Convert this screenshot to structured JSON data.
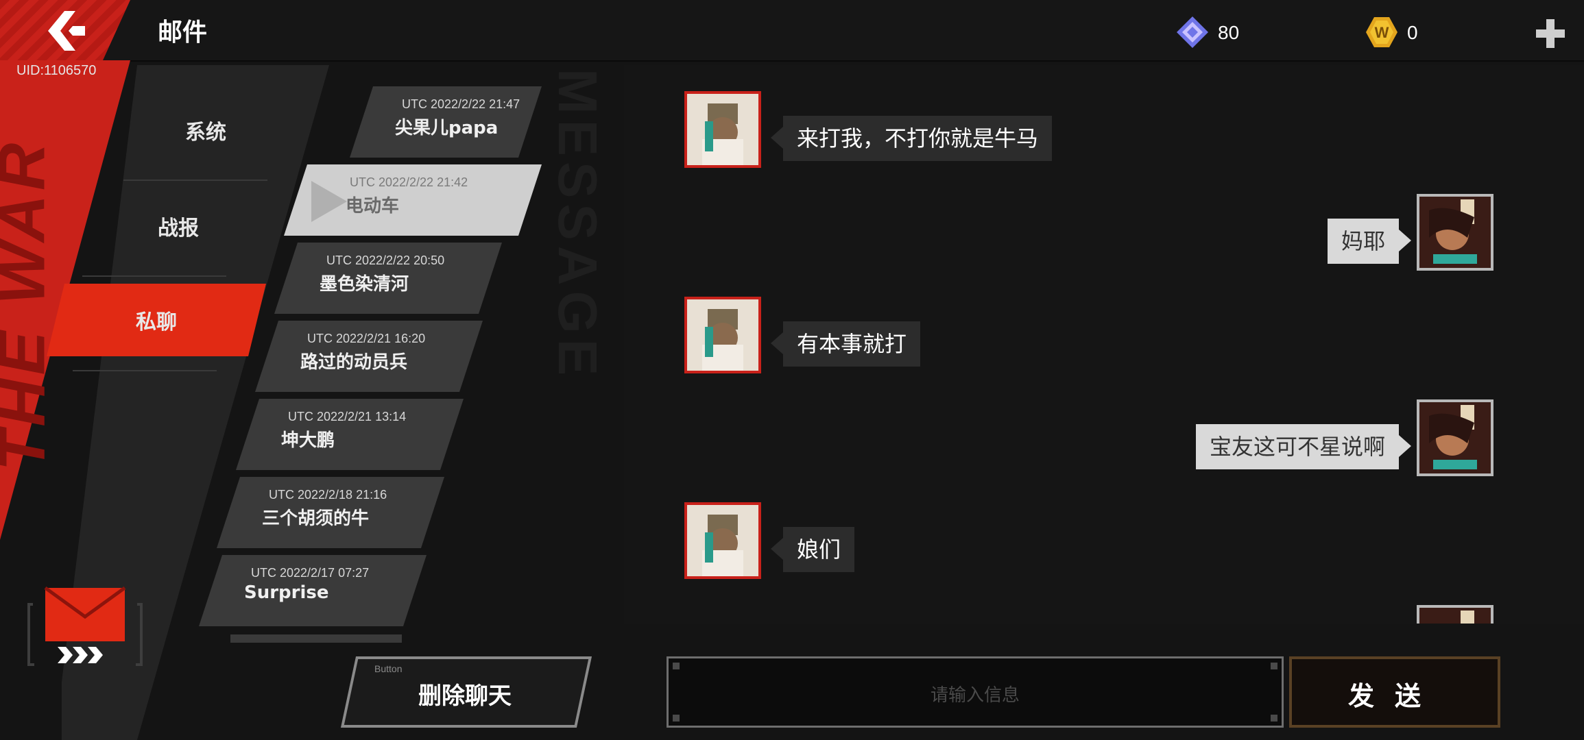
{
  "header": {
    "title": "邮件",
    "uid": "UID:1106570",
    "currencies": [
      {
        "icon": "gem-icon",
        "value": "80"
      },
      {
        "icon": "w-coin-icon",
        "value": "0"
      }
    ]
  },
  "categories": [
    {
      "label": "系统"
    },
    {
      "label": "战报"
    },
    {
      "label": "私聊",
      "active": true
    }
  ],
  "mails": [
    {
      "time": "UTC 2022/2/22 21:47",
      "name": "尖果儿papa"
    },
    {
      "time": "UTC 2022/2/22 21:42",
      "name": "电动车",
      "selected": true
    },
    {
      "time": "UTC 2022/2/22 20:50",
      "name": "墨色染清河"
    },
    {
      "time": "UTC 2022/2/21 16:20",
      "name": "路过的动员兵"
    },
    {
      "time": "UTC 2022/2/21 13:14",
      "name": "坤大鹏"
    },
    {
      "time": "UTC 2022/2/18 21:16",
      "name": "三个胡须的牛"
    },
    {
      "time": "UTC 2022/2/17 07:27",
      "name": "Surprise"
    }
  ],
  "chat": {
    "messages": [
      {
        "side": "left",
        "text": "来打我，不打你就是牛马"
      },
      {
        "side": "right",
        "text": "妈耶"
      },
      {
        "side": "left",
        "text": "有本事就打"
      },
      {
        "side": "right",
        "text": "宝友这可不星说啊"
      },
      {
        "side": "left",
        "text": "娘们"
      }
    ]
  },
  "footer": {
    "delete_small": "Button",
    "delete_label": "删除聊天",
    "input_placeholder": "请输入信息",
    "send_label": "发送"
  },
  "decor": {
    "side_text": "THE WAR",
    "message_text": "MESSAGE"
  },
  "colors": {
    "accent_red": "#c9221a",
    "selected_mail": "#cfcfcf",
    "send_border": "#5a4124"
  }
}
